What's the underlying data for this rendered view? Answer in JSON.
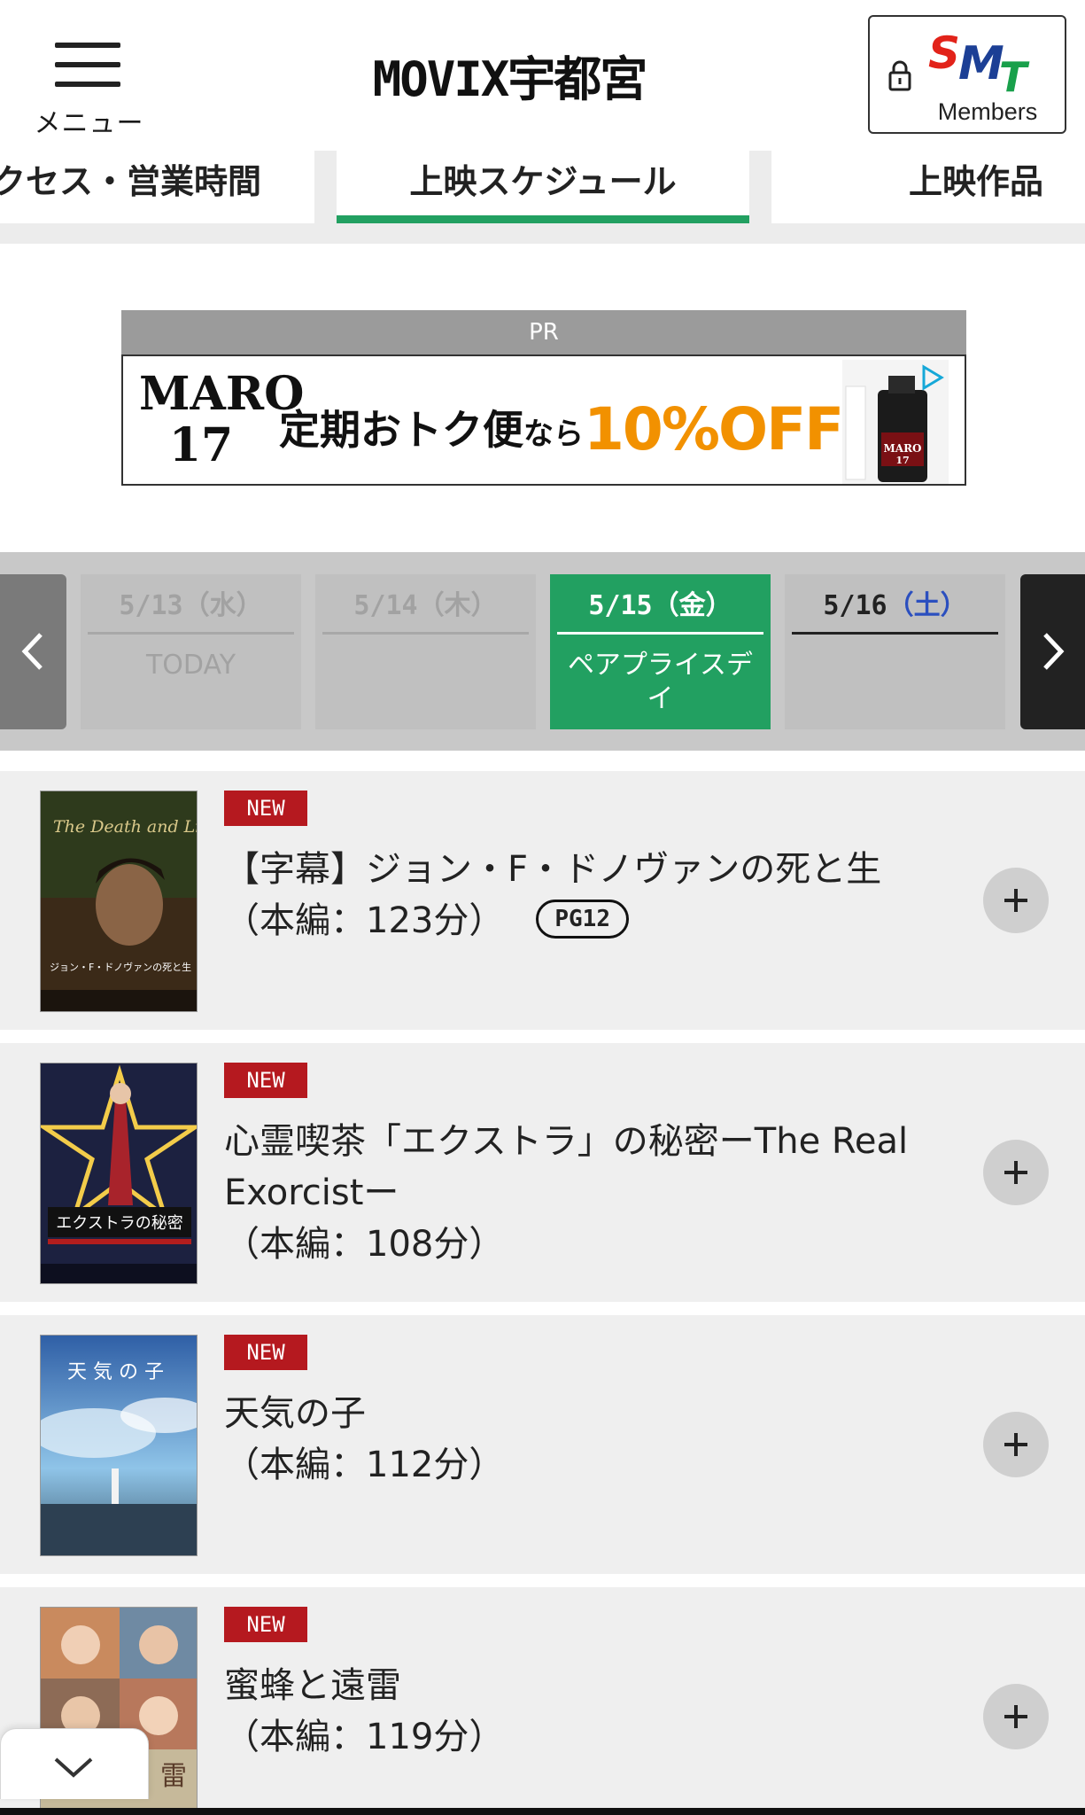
{
  "header": {
    "menu_label": "メニュー",
    "site_title": "MOVIX宇都宮",
    "members_label": "Members",
    "logo_letters": "SMT"
  },
  "tabs": [
    {
      "label": "クセス・営業時間",
      "active": false
    },
    {
      "label": "上映スケジュール",
      "active": true
    },
    {
      "label": "上映作品",
      "active": false
    }
  ],
  "ad": {
    "pr_label": "PR",
    "brand_line1": "MARO",
    "brand_line2": "17",
    "copy_main": "定期おトク便",
    "copy_small": "なら",
    "copy_offer": "10%OFF",
    "accent": "#f29100"
  },
  "date_selector": {
    "prev_icon": "chevron-left-icon",
    "next_icon": "chevron-right-icon",
    "days": [
      {
        "date": "5/13（水）",
        "sub": "TODAY",
        "state": "past"
      },
      {
        "date": "5/14（木）",
        "sub": "",
        "state": "past"
      },
      {
        "date": "5/15（金）",
        "sub": "ペアプライスデイ",
        "state": "selected"
      },
      {
        "date_num": "5/16",
        "date_day": "（土）",
        "sub": "",
        "state": "available"
      }
    ],
    "selected_color": "#22a061"
  },
  "movies": [
    {
      "badge": "NEW",
      "title": "【字幕】ジョン・F・ドノヴァンの死と生",
      "runtime": "（本編：123分）",
      "rating": "PG12",
      "poster_text": "The Death and Life of John F. Donovan",
      "poster_caption": "ジョン・F・ドノヴァンの死と生"
    },
    {
      "badge": "NEW",
      "title": "心霊喫茶「エクストラ」の秘密ーThe Real Exorcistー",
      "runtime": "（本編：108分）",
      "rating": "",
      "poster_text": "エクストラの秘密"
    },
    {
      "badge": "NEW",
      "title": "天気の子",
      "runtime": "（本編：112分）",
      "rating": "",
      "poster_text": "天 気 の 子"
    },
    {
      "badge": "NEW",
      "title": "蜜蜂と遠雷",
      "runtime": "（本編：119分）",
      "rating": "",
      "poster_text": "雷"
    }
  ],
  "colors": {
    "badge": "#b5191f",
    "tab_underline": "#22a061"
  }
}
